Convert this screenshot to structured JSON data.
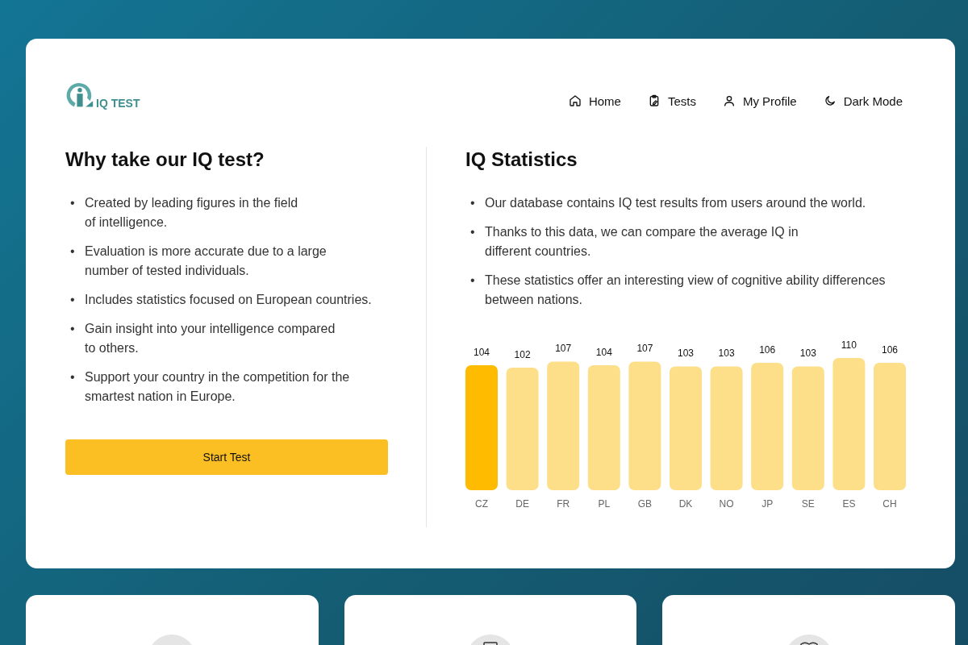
{
  "logo": {
    "text": "IQ TEST"
  },
  "nav": [
    {
      "label": "Home"
    },
    {
      "label": "Tests"
    },
    {
      "label": "My Profile"
    },
    {
      "label": "Dark Mode"
    }
  ],
  "why": {
    "title": "Why take our IQ test?",
    "items": [
      {
        "marker": "•",
        "text": "Created by leading figures in the field\nof intelligence."
      },
      {
        "marker": "•",
        "text": "Evaluation is more accurate due to a large\nnumber of tested individuals."
      },
      {
        "marker": "•",
        "text": "Includes statistics focused on European countries."
      },
      {
        "marker": "•",
        "text": "Gain insight into your intelligence compared\nto others."
      },
      {
        "marker": "•",
        "text": "Support your country in the competition for the\nsmartest nation in Europe."
      }
    ],
    "button": "Start Test"
  },
  "stats": {
    "title": "IQ Statistics",
    "items": [
      {
        "marker": "•",
        "text": "Our database contains IQ test results from users around the world."
      },
      {
        "marker": "•",
        "text": "Thanks to this data, we can compare the average IQ in\ndifferent countries."
      },
      {
        "marker": "•",
        "text": "These statistics offer an interesting view of cognitive ability differences\nbetween nations."
      }
    ],
    "chart_data": {
      "type": "bar",
      "categories": [
        "CZ",
        "DE",
        "FR",
        "PL",
        "GB",
        "DK",
        "NO",
        "JP",
        "SE",
        "ES",
        "CH"
      ],
      "stacked": true,
      "data_labels": true,
      "series": [
        {
          "color": "#ffbb00",
          "values": [
            104,
            null,
            null,
            null,
            null,
            null,
            null,
            null,
            null,
            null,
            null
          ]
        },
        {
          "color": "#fddf8a",
          "values": [
            null,
            102,
            107,
            104,
            107,
            103,
            103,
            106,
            103,
            110,
            106
          ]
        }
      ]
    }
  },
  "cards": [
    {
      "kind": "feature"
    },
    {
      "kind": "feature"
    },
    {
      "kind": "feature"
    }
  ]
}
